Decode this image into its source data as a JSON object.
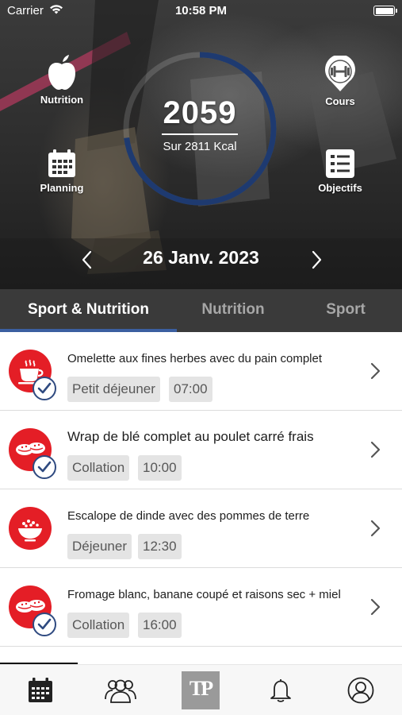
{
  "status_bar": {
    "carrier": "Carrier",
    "time": "10:58 PM"
  },
  "hero": {
    "nutrition_label": "Nutrition",
    "planning_label": "Planning",
    "cours_label": "Cours",
    "objectifs_label": "Objectifs",
    "calories": "2059",
    "calories_total": "Sur 2811 Kcal",
    "calorie_progress": 0.73,
    "date": "26 Janv. 2023",
    "accent_color": "#1e3a70"
  },
  "tabs": [
    {
      "label": "Sport & Nutrition",
      "active": true
    },
    {
      "label": "Nutrition",
      "active": false
    },
    {
      "label": "Sport",
      "active": false
    }
  ],
  "meals": [
    {
      "title": "Omelette aux fines herbes avec du pain complet",
      "type": "Petit déjeuner",
      "time": "07:00",
      "icon": "cup-icon",
      "checked": true
    },
    {
      "title": "Wrap de blé complet au poulet carré frais",
      "type": "Collation",
      "time": "10:00",
      "icon": "cookies-icon",
      "checked": true
    },
    {
      "title": "Escalope de dinde avec des pommes de terre",
      "type": "Déjeuner",
      "time": "12:30",
      "icon": "bowl-icon",
      "checked": false
    },
    {
      "title": "Fromage blanc, banane coupé et raisons sec + miel",
      "type": "Collation",
      "time": "16:00",
      "icon": "cookies-icon",
      "checked": true
    }
  ],
  "bottom_nav": {
    "items": [
      "calendar-icon",
      "group-icon",
      "logo-icon",
      "bell-icon",
      "profile-icon"
    ],
    "logo_text": "TP"
  },
  "colors": {
    "meal_red": "#e41e26",
    "check_blue": "#2f4a80",
    "tab_bar": "#3a3a3a",
    "tab_underline": "#3b5fa0"
  }
}
